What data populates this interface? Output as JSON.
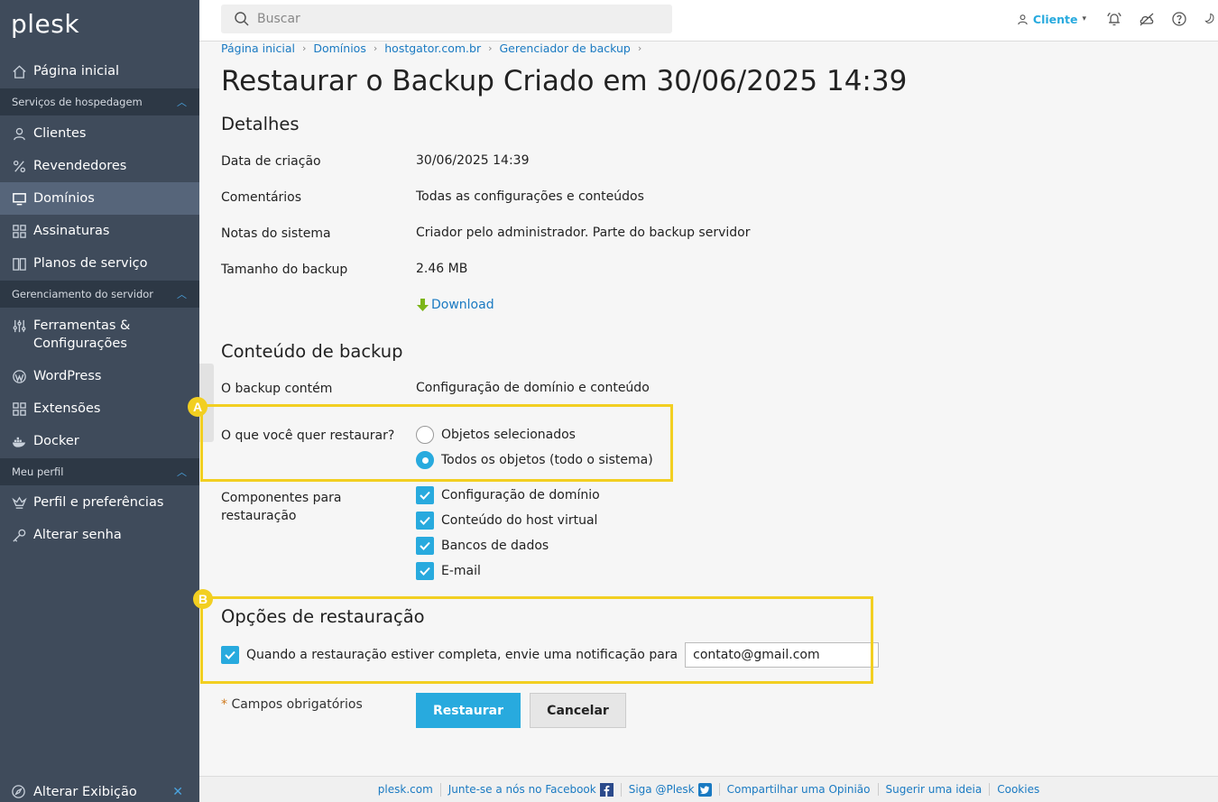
{
  "app": {
    "logo": "plesk"
  },
  "sidebar": {
    "home": "Página inicial",
    "sections": [
      {
        "title": "Serviços de hospedagem"
      },
      {
        "title": "Gerenciamento do servidor"
      },
      {
        "title": "Meu perfil"
      }
    ],
    "items": {
      "clientes": "Clientes",
      "revendedores": "Revendedores",
      "dominios": "Domínios",
      "assinaturas": "Assinaturas",
      "planos": "Planos de serviço",
      "ferramentas1": "Ferramentas &",
      "ferramentas2": "Configurações",
      "wordpress": "WordPress",
      "extensoes": "Extensões",
      "docker": "Docker",
      "perfil": "Perfil e preferências",
      "senha": "Alterar senha"
    },
    "bottom": "Alterar Exibição"
  },
  "topbar": {
    "search_placeholder": "Buscar",
    "user": "Cliente"
  },
  "breadcrumb": [
    "Página inicial",
    "Domínios",
    "hostgator.com.br",
    "Gerenciador de backup"
  ],
  "page_title": "Restaurar o Backup Criado em 30/06/2025 14:39",
  "details": {
    "title": "Detalhes",
    "rows": [
      {
        "label": "Data de criação",
        "value": "30/06/2025 14:39"
      },
      {
        "label": "Comentários",
        "value": "Todas as configurações e conteúdos"
      },
      {
        "label": "Notas do sistema",
        "value": "Criador pelo administrador. Parte do backup servidor"
      },
      {
        "label": "Tamanho do backup",
        "value": "2.46 MB"
      }
    ],
    "download": "Download"
  },
  "backup_content": {
    "title": "Conteúdo de backup",
    "contains_label": "O backup contém",
    "contains_value": "Configuração de domínio e conteúdo",
    "restore_label": "O que você quer restaurar?",
    "options": [
      {
        "label": "Objetos selecionados",
        "selected": false
      },
      {
        "label": "Todos os objetos (todo o sistema)",
        "selected": true
      }
    ],
    "components_label_1": "Componentes para",
    "components_label_2": "restauração",
    "components": [
      {
        "label": "Configuração de domínio",
        "checked": true
      },
      {
        "label": "Conteúdo do host virtual",
        "checked": true
      },
      {
        "label": "Bancos de dados",
        "checked": true
      },
      {
        "label": "E-mail",
        "checked": true
      }
    ]
  },
  "restore_options": {
    "title": "Opções de restauração",
    "notify_label": "Quando a restauração estiver completa, envie uma notificação para",
    "notify_checked": true,
    "email": "contato@gmail.com"
  },
  "required_note": "Campos obrigatórios",
  "required_star": "*",
  "buttons": {
    "restore": "Restaurar",
    "cancel": "Cancelar"
  },
  "annotations": {
    "a": "A",
    "b": "B"
  },
  "footer": [
    {
      "label": "plesk.com"
    },
    {
      "label": "Junte-se a nós no Facebook",
      "icon": "facebook-icon"
    },
    {
      "label": "Siga @Plesk",
      "icon": "twitter-icon"
    },
    {
      "label": "Compartilhar uma Opinião"
    },
    {
      "label": "Sugerir uma ideia"
    },
    {
      "label": "Cookies"
    }
  ],
  "colors": {
    "sidebar": "#3f4b5b",
    "accent": "#28aade",
    "link": "#1a7ac2",
    "highlight": "#f2cf21"
  }
}
